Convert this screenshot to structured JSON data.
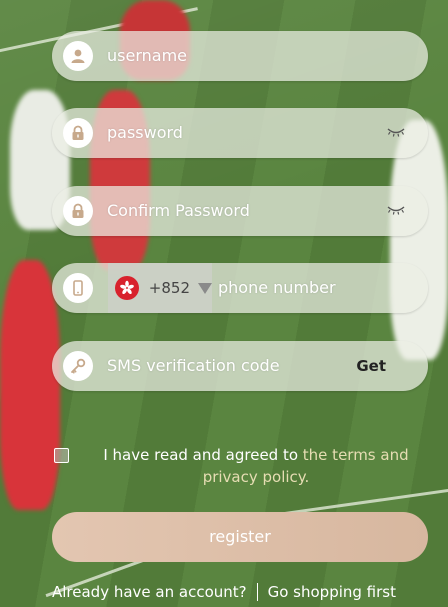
{
  "form": {
    "username_placeholder": "username",
    "password_placeholder": "password",
    "confirm_password_placeholder": "Confirm Password",
    "phone_country_code": "+852",
    "phone_placeholder": "phone number",
    "sms_placeholder": "SMS verification code",
    "sms_get_label": "Get"
  },
  "agreement": {
    "text_prefix": "I have read and agreed to",
    "link_text": "the terms and privacy policy."
  },
  "register_label": "register",
  "footer": {
    "login_link": "Already have an account?",
    "shop_link": "Go shopping first"
  },
  "icons": {
    "username": "user-icon",
    "password": "lock-icon",
    "confirm_password": "lock-icon",
    "phone": "phone-icon",
    "sms": "key-icon",
    "flag": "hong-kong-flag-icon"
  },
  "colors": {
    "register_button": "#ddbfa8",
    "terms_link": "#e6ddb3",
    "flag_red": "#d8222d"
  }
}
